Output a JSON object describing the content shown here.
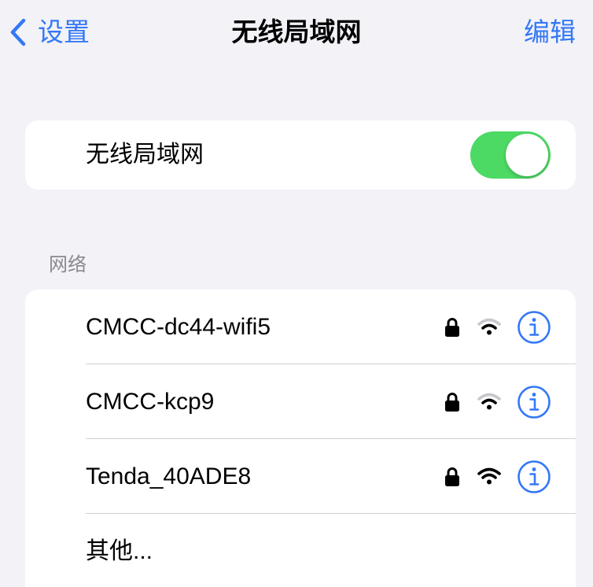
{
  "nav": {
    "back_label": "设置",
    "title": "无线局域网",
    "edit_label": "编辑"
  },
  "wifi": {
    "label": "无线局域网",
    "enabled": true
  },
  "networks": {
    "header": "网络",
    "items": [
      {
        "name": "CMCC-dc44-wifi5",
        "secured": true,
        "signal": "weak"
      },
      {
        "name": "CMCC-kcp9",
        "secured": true,
        "signal": "weak"
      },
      {
        "name": "Tenda_40ADE8",
        "secured": true,
        "signal": "full"
      }
    ],
    "other_label": "其他..."
  },
  "colors": {
    "accent": "#3478f6",
    "toggle_on": "#4cd964",
    "background": "#f2f2f7",
    "secondary_text": "#8a8a8e"
  },
  "icons": {
    "back": "chevron-left-icon",
    "lock": "lock-icon",
    "signal": "wifi-signal-icon",
    "info": "info-circle-icon"
  }
}
